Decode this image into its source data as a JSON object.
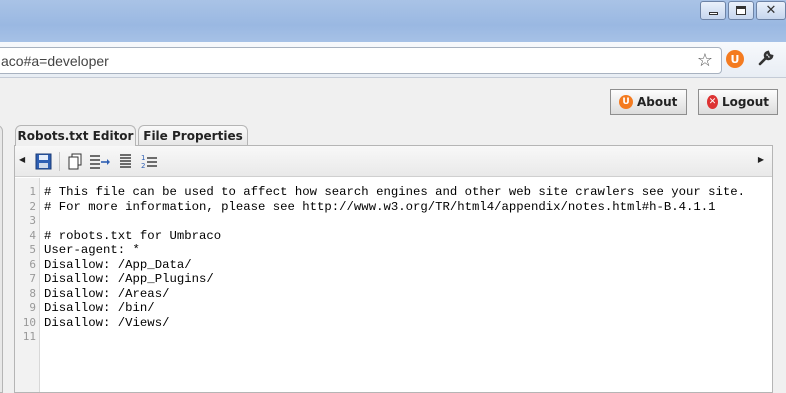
{
  "window": {
    "controls": [
      "minimize",
      "maximize",
      "close"
    ]
  },
  "browser": {
    "url": "aco#a=developer",
    "star_icon": "star-icon",
    "extension_icon": "umbraco-icon",
    "menu_icon": "wrench-icon"
  },
  "header": {
    "about_label": "About",
    "logout_label": "Logout"
  },
  "tabs": [
    {
      "label": "Robots.txt Editor",
      "active": true
    },
    {
      "label": "File Properties",
      "active": false
    }
  ],
  "editor_toolbar": {
    "buttons": [
      "save-icon",
      "copy-icon",
      "indent-icon",
      "align-icon",
      "numbered-list-icon"
    ]
  },
  "editor": {
    "lines": [
      {
        "n": "1",
        "text": "# This file can be used to affect how search engines and other web site crawlers see your site."
      },
      {
        "n": "2",
        "text": "# For more information, please see http://www.w3.org/TR/html4/appendix/notes.html#h-B.4.1.1"
      },
      {
        "n": "3",
        "text": ""
      },
      {
        "n": "4",
        "text": "# robots.txt for Umbraco"
      },
      {
        "n": "5",
        "text": "User-agent: *"
      },
      {
        "n": "6",
        "text": "Disallow: /App_Data/"
      },
      {
        "n": "7",
        "text": "Disallow: /App_Plugins/"
      },
      {
        "n": "8",
        "text": "Disallow: /Areas/"
      },
      {
        "n": "9",
        "text": "Disallow: /bin/"
      },
      {
        "n": "10",
        "text": "Disallow: /Views/"
      },
      {
        "n": "11",
        "text": ""
      }
    ]
  },
  "colors": {
    "titlebar": "#9ab8e2",
    "accent_orange": "#f47b20",
    "logout_red": "#d33333"
  }
}
